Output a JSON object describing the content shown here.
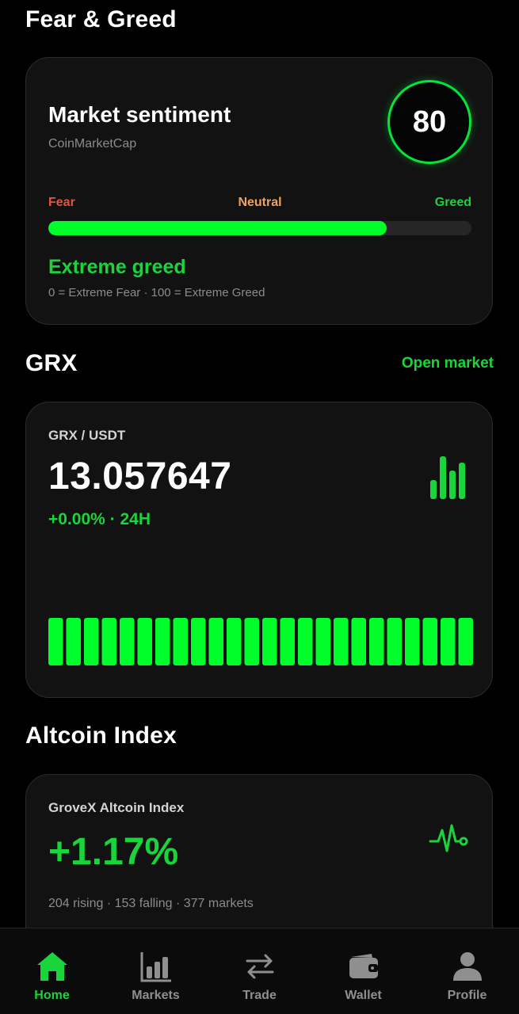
{
  "colors": {
    "accent": "#19d43a",
    "bright_green": "#00ff2a",
    "fear": "#e8533f",
    "neutral": "#f2a25c",
    "card_bg": "#121212",
    "muted_text": "#8c8c8c"
  },
  "fear_greed": {
    "section_title": "Fear & Greed",
    "card_title": "Market sentiment",
    "source": "CoinMarketCap",
    "score": "80",
    "score_fraction": 0.8,
    "label_fear": "Fear",
    "label_neutral": "Neutral",
    "label_greed": "Greed",
    "status": "Extreme greed",
    "legend": "0 = Extreme Fear · 100 = Extreme Greed"
  },
  "grx": {
    "section_title": "GRX",
    "open_market_label": "Open market",
    "pair": "GRX / USDT",
    "price": "13.057647",
    "change": "+0.00% · 24H",
    "icon": "bar-chart-icon",
    "chart_bar_count": 24
  },
  "altcoin": {
    "section_title": "Altcoin Index",
    "name": "GroveX Altcoin Index",
    "value": "+1.17%",
    "meta": "204 rising · 153 falling · 377 markets",
    "icon": "pulse-icon"
  },
  "nav": {
    "items": [
      {
        "label": "Home",
        "icon": "home-icon",
        "active": true
      },
      {
        "label": "Markets",
        "icon": "markets-icon",
        "active": false
      },
      {
        "label": "Trade",
        "icon": "swap-icon",
        "active": false
      },
      {
        "label": "Wallet",
        "icon": "wallet-icon",
        "active": false
      },
      {
        "label": "Profile",
        "icon": "profile-icon",
        "active": false
      }
    ]
  }
}
